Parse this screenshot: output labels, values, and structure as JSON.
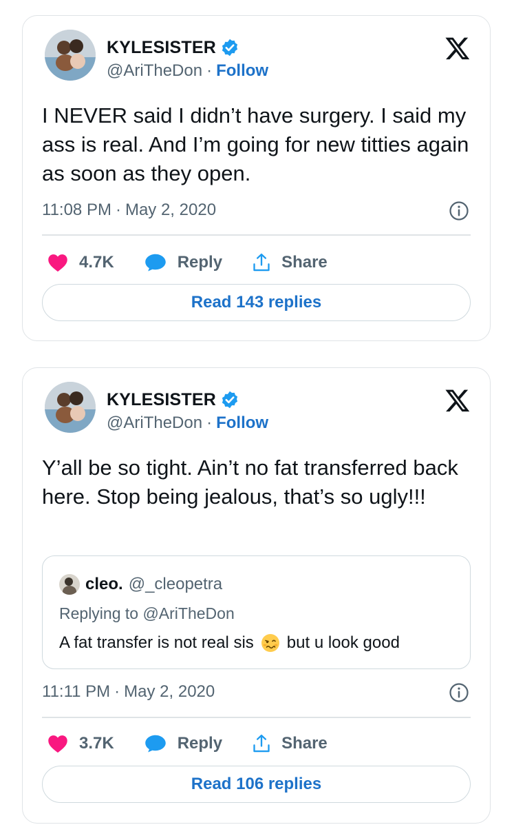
{
  "tweets": [
    {
      "display_name": "KYLESISTER",
      "handle": "@AriTheDon",
      "separator": "·",
      "follow_label": "Follow",
      "text": "I NEVER said I didn’t have surgery. I said my ass is real. And I’m going for new titties again as soon as they open.",
      "time": "11:08 PM",
      "date": "May 2, 2020",
      "likes": "4.7K",
      "reply_label": "Reply",
      "share_label": "Share",
      "read_replies_label": "Read 143 replies"
    },
    {
      "display_name": "KYLESISTER",
      "handle": "@AriTheDon",
      "separator": "·",
      "follow_label": "Follow",
      "text": "Y’all be so tight. Ain’t no fat transferred back here. Stop being jealous, that’s so ugly!!!",
      "quote": {
        "name": "cleo.",
        "handle": "@_cleopetra",
        "replying_to": "Replying to @AriTheDon",
        "text_before": "A fat transfer is not real sis",
        "emoji_icon": "woozy-face-icon",
        "text_after": "but u look good"
      },
      "time": "11:11 PM",
      "date": "May 2, 2020",
      "likes": "3.7K",
      "reply_label": "Reply",
      "share_label": "Share",
      "read_replies_label": "Read 106 replies"
    }
  ],
  "icons": {
    "verified": "verified-badge-icon",
    "platform": "x-logo-icon",
    "info": "info-icon",
    "like": "heart-icon",
    "reply": "speech-bubble-icon",
    "share": "share-icon"
  },
  "colors": {
    "link": "#1d72c9",
    "heart": "#f91880",
    "reply_bubble": "#1d9bf0",
    "muted_text": "#536471",
    "border": "#dfe3e6"
  }
}
